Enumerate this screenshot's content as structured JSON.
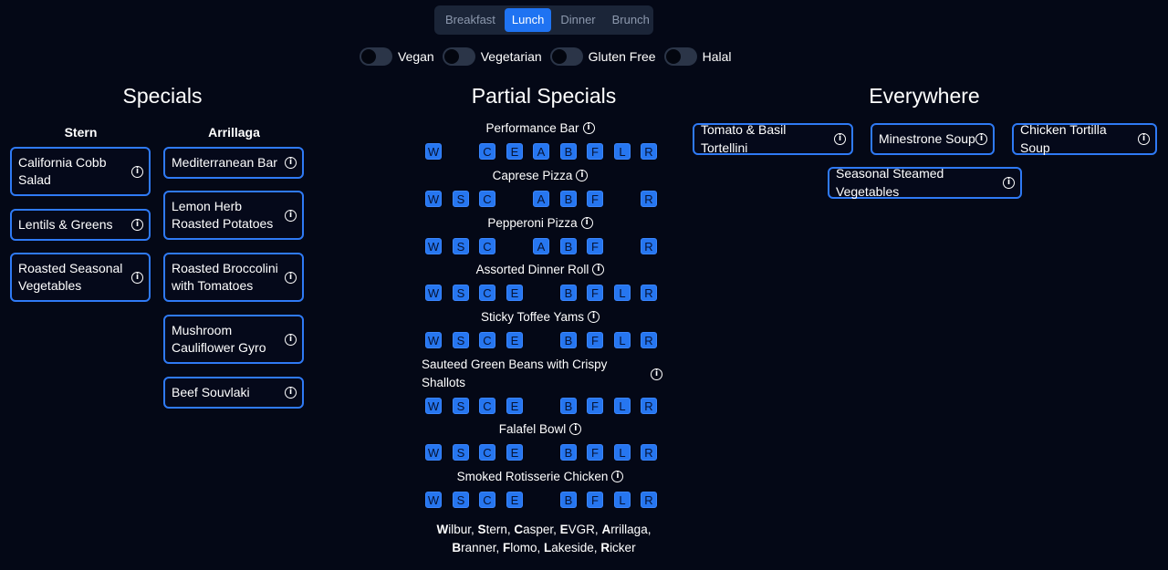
{
  "meal_tabs": {
    "items": [
      "Breakfast",
      "Lunch",
      "Dinner",
      "Brunch"
    ],
    "active": "Lunch"
  },
  "filters": [
    {
      "label": "Vegan",
      "on": false
    },
    {
      "label": "Vegetarian",
      "on": false
    },
    {
      "label": "Gluten Free",
      "on": false
    },
    {
      "label": "Halal",
      "on": false
    }
  ],
  "specials": {
    "title": "Specials",
    "columns": [
      {
        "heading": "Stern",
        "items": [
          "California Cobb Salad",
          "Lentils & Greens",
          "Roasted Seasonal Vegetables"
        ]
      },
      {
        "heading": "Arrillaga",
        "items": [
          "Mediterranean Bar",
          "Lemon Herb Roasted Potatoes",
          "Roasted Broccolini with Tomatoes",
          "Mushroom Cauliflower Gyro",
          "Beef Souvlaki"
        ]
      }
    ]
  },
  "partial_specials": {
    "title": "Partial Specials",
    "dining_hall_letters": [
      "W",
      "S",
      "C",
      "E",
      "A",
      "B",
      "F",
      "L",
      "R"
    ],
    "items": [
      {
        "name": "Performance Bar",
        "halls": [
          "W",
          "C",
          "E",
          "A",
          "B",
          "F",
          "L",
          "R"
        ]
      },
      {
        "name": "Caprese Pizza",
        "halls": [
          "W",
          "S",
          "C",
          "A",
          "B",
          "F",
          "R"
        ]
      },
      {
        "name": "Pepperoni Pizza",
        "halls": [
          "W",
          "S",
          "C",
          "A",
          "B",
          "F",
          "R"
        ]
      },
      {
        "name": "Assorted Dinner Roll",
        "halls": [
          "W",
          "S",
          "C",
          "E",
          "B",
          "F",
          "L",
          "R"
        ]
      },
      {
        "name": "Sticky Toffee Yams",
        "halls": [
          "W",
          "S",
          "C",
          "E",
          "B",
          "F",
          "L",
          "R"
        ]
      },
      {
        "name": "Sauteed Green Beans with Crispy Shallots",
        "halls": [
          "W",
          "S",
          "C",
          "E",
          "B",
          "F",
          "L",
          "R"
        ]
      },
      {
        "name": "Falafel Bowl",
        "halls": [
          "W",
          "S",
          "C",
          "E",
          "B",
          "F",
          "L",
          "R"
        ]
      },
      {
        "name": "Smoked Rotisserie Chicken",
        "halls": [
          "W",
          "S",
          "C",
          "E",
          "B",
          "F",
          "L",
          "R"
        ]
      }
    ],
    "legend": [
      {
        "initial": "W",
        "rest": "ilbur"
      },
      {
        "initial": "S",
        "rest": "tern"
      },
      {
        "initial": "C",
        "rest": "asper"
      },
      {
        "initial": "E",
        "rest": "VGR"
      },
      {
        "initial": "A",
        "rest": "rrillaga"
      },
      {
        "initial": "B",
        "rest": "ranner"
      },
      {
        "initial": "F",
        "rest": "lomo"
      },
      {
        "initial": "L",
        "rest": "akeside"
      },
      {
        "initial": "R",
        "rest": "icker"
      }
    ]
  },
  "everywhere": {
    "title": "Everywhere",
    "items": [
      "Tomato & Basil Tortellini",
      "Minestrone Soup",
      "Chicken Tortilla Soup",
      "Seasonal Steamed Vegetables"
    ]
  },
  "colors": {
    "background": "#040816",
    "accent": "#1f73f2",
    "card_border": "#2f7af5",
    "badge": "#2676f0"
  },
  "icons": {
    "info": "info-circle-icon"
  }
}
